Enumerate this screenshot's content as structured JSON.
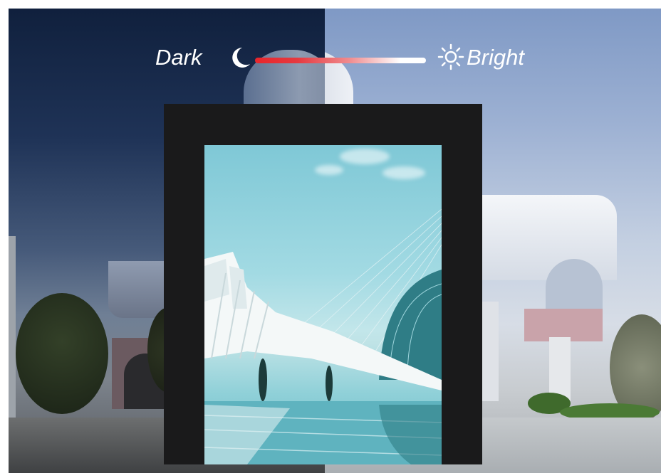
{
  "slider": {
    "left_label": "Dark",
    "right_label": "Bright",
    "left_icon": "moon-icon",
    "right_icon": "sun-icon",
    "track_colors": [
      "#e8262c",
      "#ffffff"
    ]
  },
  "scene": {
    "dark_side_color": "#1f3357",
    "bright_side_color": "#9db1d3",
    "frame_color": "#1a1a1b",
    "screen_accent": "#7fc8d6"
  }
}
